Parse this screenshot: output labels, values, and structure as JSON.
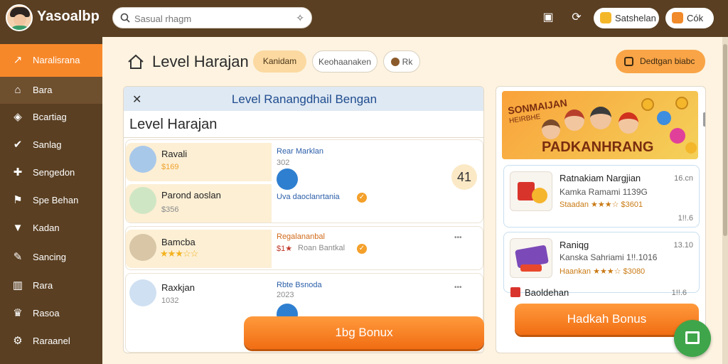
{
  "app": {
    "title": "Yasoalbp"
  },
  "search": {
    "placeholder": "Sasual rhagm"
  },
  "topbar": {
    "btn1_label": "Satshelan",
    "btn2_label": "Cók"
  },
  "sidebar": {
    "items": [
      {
        "label": "Naralisrana",
        "icon": "chart-icon"
      },
      {
        "label": "Bara",
        "icon": "home-icon"
      },
      {
        "label": "Bcartiag",
        "icon": "shield-icon"
      },
      {
        "label": "Sanlag",
        "icon": "check-icon"
      },
      {
        "label": "Sengedon",
        "icon": "puzzle-icon"
      },
      {
        "label": "Spe Behan",
        "icon": "tag-icon"
      },
      {
        "label": "Kadan",
        "icon": "gift-icon"
      },
      {
        "label": "Sancing",
        "icon": "edit-icon"
      },
      {
        "label": "Rara",
        "icon": "book-icon"
      },
      {
        "label": "Rasoa",
        "icon": "trophy-icon"
      },
      {
        "label": "Raraanel",
        "icon": "gear-icon"
      }
    ]
  },
  "header": {
    "title": "Level Harajan",
    "chips": [
      "Kanidam",
      "Keohaanaken",
      "Rk"
    ],
    "right_button": "Dedtgan biabc"
  },
  "panel": {
    "header_title": "Level Ranangdhail Bengan",
    "subtitle": "Level Harajan",
    "rows": [
      {
        "title": "Ravali",
        "sub": "$169"
      },
      {
        "title": "Parond aoslan",
        "sub": "$356"
      },
      {
        "title": "Bamcba",
        "stars": "★★★☆☆"
      },
      {
        "title": "Raxkjan",
        "sub": "1032"
      }
    ],
    "right_rows": [
      {
        "title": "Rear Marklan",
        "sub": "302",
        "link": "Uva daoclanrtania"
      },
      {
        "title": "Regalananbal",
        "sub": "Roan Bantkal",
        "tag": "$1★"
      },
      {
        "title": "Rbte Bsnoda",
        "sub": "2023"
      }
    ],
    "round_number": "41",
    "bonus_button": "1bg Bonux"
  },
  "right_panel": {
    "banner": {
      "line1": "SONMAIJAN",
      "line2": "HEIRBHE",
      "line3": "PADKANHRANG"
    },
    "cards": [
      {
        "title": "Ratnakiam Nargjian",
        "sub": "Kamka Ramami 1139G",
        "meta": "Staadan ★★★☆ $3601",
        "time1": "16.cn",
        "time2": "1!!.6"
      },
      {
        "title": "Raniqg",
        "sub": "Kanska Sahriami 1!!.1016",
        "meta": "Haankan ★★★☆ $3080",
        "time1": "13.10",
        "time2": ""
      }
    ],
    "third_title": "Baoldehan",
    "third_time": "1!!.6",
    "bonus_button": "Hadkah Bonus"
  },
  "colors": {
    "primary": "#f7882a",
    "sidebar_bg": "#5a3f22",
    "page_bg": "#fdf3e0",
    "accent_blue": "#1f4c8f",
    "fab": "#3fa54a"
  }
}
